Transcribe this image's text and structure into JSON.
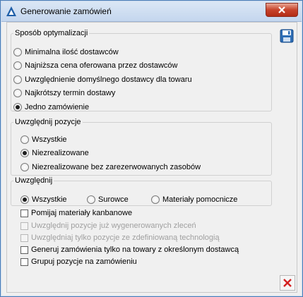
{
  "window": {
    "title": "Generowanie zamówień"
  },
  "optimization": {
    "legend": "Sposób optymalizacji",
    "options": [
      {
        "label": "Minimalna ilość dostawców",
        "checked": false
      },
      {
        "label": "Najniższa cena oferowana przez dostawców",
        "checked": false
      },
      {
        "label": "Uwzględnienie domyślnego dostawcy dla towaru",
        "checked": false
      },
      {
        "label": "Najkrótszy termin dostawy",
        "checked": false
      },
      {
        "label": "Jedno zamówienie",
        "checked": true
      }
    ]
  },
  "positions": {
    "legend": "Uwzględnij pozycje",
    "options": [
      {
        "label": "Wszystkie",
        "checked": false
      },
      {
        "label": "Niezrealizowane",
        "checked": true
      },
      {
        "label": "Niezrealizowane bez zarezerwowanych zasobów",
        "checked": false
      }
    ]
  },
  "include": {
    "legend": "Uwzględnij",
    "options": [
      {
        "label": "Wszystkie",
        "checked": true
      },
      {
        "label": "Surowce",
        "checked": false
      },
      {
        "label": "Materiały pomocnicze",
        "checked": false
      }
    ]
  },
  "checkboxes": [
    {
      "label": "Pomijaj materiały kanbanowe",
      "checked": false,
      "enabled": true
    },
    {
      "label": "Uwzględnij pozycje już wygenerowanych zleceń",
      "checked": false,
      "enabled": false
    },
    {
      "label": "Uwzględniaj tylko pozycje ze zdefiniowaną technologią",
      "checked": false,
      "enabled": false
    },
    {
      "label": "Generuj zamówienia tylko na towary z określonym dostawcą",
      "checked": false,
      "enabled": true
    },
    {
      "label": "Grupuj pozycje na zamówieniu",
      "checked": false,
      "enabled": true
    }
  ],
  "colors": {
    "accent": "#1f5fa8",
    "close": "#c7432b",
    "cancel": "#d42020"
  },
  "icons": {
    "app": "app-logo-icon",
    "close": "close-icon",
    "save": "save-disk-icon",
    "cancel": "cancel-x-icon"
  }
}
